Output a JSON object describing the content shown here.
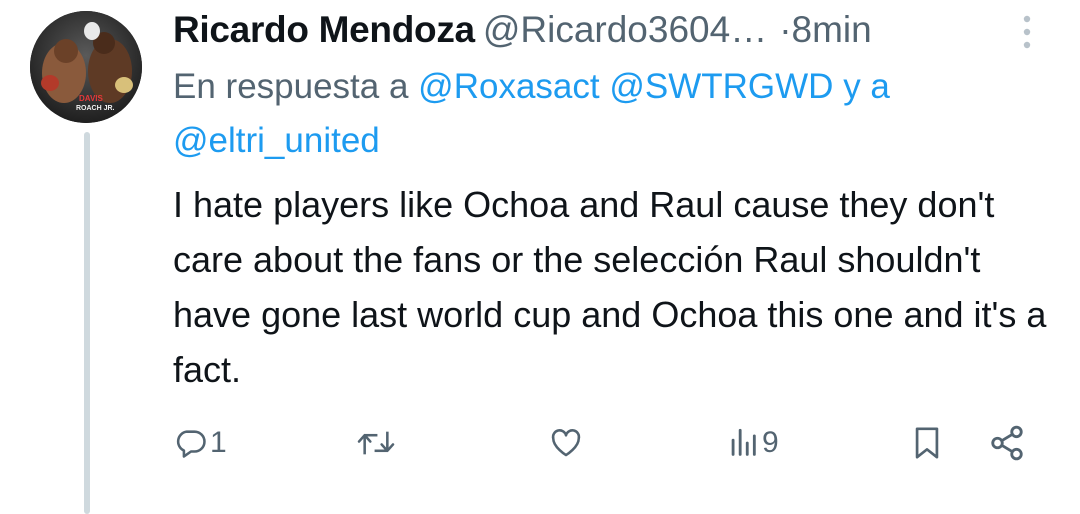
{
  "tweet": {
    "display_name": "Ricardo Mendoza",
    "handle": "@Ricardo3604…",
    "separator": "·",
    "time": "8min",
    "avatar_text_line1": "DAVIS",
    "avatar_text_line2": "ROACH JR.",
    "reply_prefix": "En respuesta a",
    "reply_mentions": [
      "@Roxasact",
      "@SWTRGWD",
      "@eltri_united"
    ],
    "reply_conjunction": "y a",
    "text": "I hate players like Ochoa and Raul cause they don't care about the fans or the selección Raul shouldn't have gone last world cup and Ochoa this one and it's a fact."
  },
  "actions": {
    "reply_count": "1",
    "retweet_count": "",
    "like_count": "",
    "views_count": "9"
  },
  "colors": {
    "text": "#0f1419",
    "secondary": "#536471",
    "link": "#1d9bf0",
    "thread_line": "#cfd9de"
  },
  "icons": [
    "more-vertical-icon",
    "reply-icon",
    "retweet-icon",
    "like-icon",
    "views-icon",
    "bookmark-icon",
    "share-icon"
  ]
}
